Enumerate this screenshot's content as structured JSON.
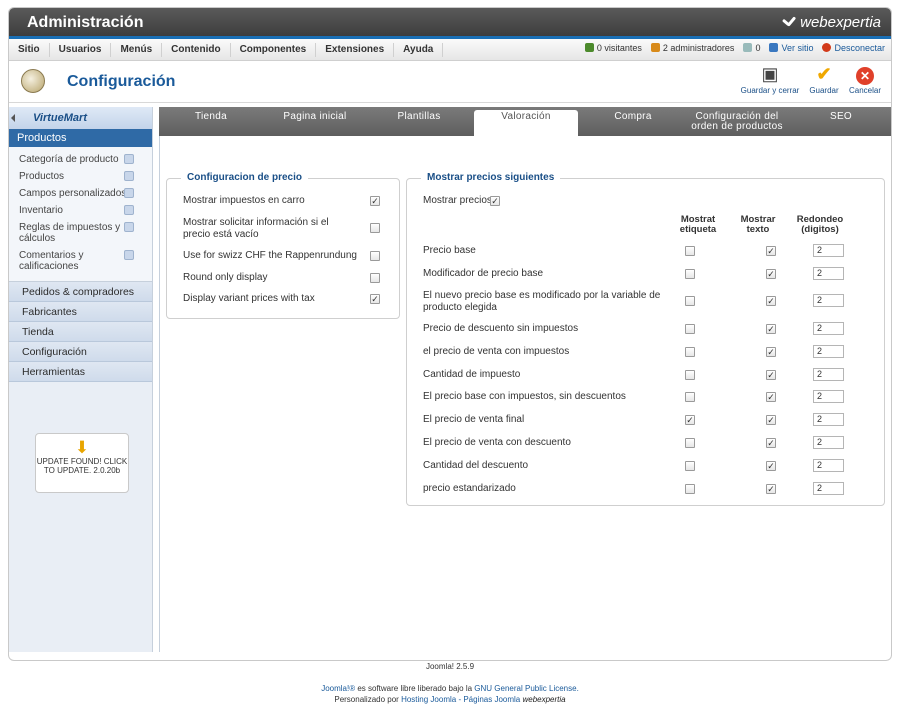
{
  "header": {
    "title": "Administración",
    "brand": "webexpertia"
  },
  "menu": [
    "Sitio",
    "Usuarios",
    "Menús",
    "Contenido",
    "Componentes",
    "Extensiones",
    "Ayuda"
  ],
  "status": {
    "visitors": "0 visitantes",
    "admins": "2 administradores",
    "messages": "0",
    "view_site": "Ver sitio",
    "logout": "Desconectar"
  },
  "toolbar": {
    "title": "Configuración",
    "save_close": "Guardar y cerrar",
    "save": "Guardar",
    "cancel": "Cancelar"
  },
  "sidebar": {
    "logo": "VirtueMart",
    "active_section": "Productos",
    "items": [
      {
        "label": "Categoría de producto"
      },
      {
        "label": "Productos"
      },
      {
        "label": "Campos personalizados"
      },
      {
        "label": "Inventario"
      },
      {
        "label": "Reglas de impuestos y cálculos"
      },
      {
        "label": "Comentarios y calificaciones"
      }
    ],
    "sections": [
      "Pedidos & compradores",
      "Fabricantes",
      "Tienda",
      "Configuración",
      "Herramientas"
    ],
    "update": "UPDATE FOUND! CLICK TO UPDATE. 2.0.20b"
  },
  "tabs": [
    "Tienda",
    "Pagina inicial",
    "Plantillas",
    "Valoración",
    "Compra",
    "Configuración del orden de productos",
    "SEO"
  ],
  "price_config": {
    "legend": "Configuracion de precio",
    "rows": [
      {
        "label": "Mostrar impuestos en carro",
        "checked": true
      },
      {
        "label": "Mostrar solicitar información si el precio está vacío",
        "checked": false
      },
      {
        "label": "Use for swizz CHF the Rappenrundung",
        "checked": false
      },
      {
        "label": "Round only display",
        "checked": false
      },
      {
        "label": "Display variant prices with tax",
        "checked": true
      }
    ]
  },
  "show_prices": {
    "legend": "Mostrar precios siguientes",
    "toggle_label": "Mostrar precios",
    "toggle_checked": true,
    "col_label": "Mostrat etiqueta",
    "col_text": "Mostrar texto",
    "col_round": "Redondeo (digitos)",
    "rows": [
      {
        "label": "Precio base",
        "label_cb": false,
        "text_cb": true,
        "round": "2"
      },
      {
        "label": "Modificador de precio base",
        "label_cb": false,
        "text_cb": true,
        "round": "2"
      },
      {
        "label": "El nuevo precio base es modificado por la variable de producto elegida",
        "label_cb": false,
        "text_cb": true,
        "round": "2"
      },
      {
        "label": "Precio de descuento sin impuestos",
        "label_cb": false,
        "text_cb": true,
        "round": "2"
      },
      {
        "label": "el precio de venta con impuestos",
        "label_cb": false,
        "text_cb": true,
        "round": "2"
      },
      {
        "label": "Cantidad de impuesto",
        "label_cb": false,
        "text_cb": true,
        "round": "2"
      },
      {
        "label": "El precio base con impuestos, sin descuentos",
        "label_cb": false,
        "text_cb": true,
        "round": "2"
      },
      {
        "label": "El precio de venta final",
        "label_cb": true,
        "text_cb": true,
        "round": "2"
      },
      {
        "label": "El precio de venta con descuento",
        "label_cb": false,
        "text_cb": true,
        "round": "2"
      },
      {
        "label": "Cantidad del descuento",
        "label_cb": false,
        "text_cb": true,
        "round": "2"
      },
      {
        "label": "precio estandarizado",
        "label_cb": false,
        "text_cb": true,
        "round": "2"
      }
    ]
  },
  "footer": {
    "version": "Joomla! 2.5.9",
    "license_prefix": "Joomla!® es software libre liberado bajo la",
    "license_link": "GNU General Public License.",
    "custom_prefix": "Personalizado por",
    "custom_link": "Hosting Joomla - Páginas Joomla",
    "custom_brand": "webexpertia"
  }
}
